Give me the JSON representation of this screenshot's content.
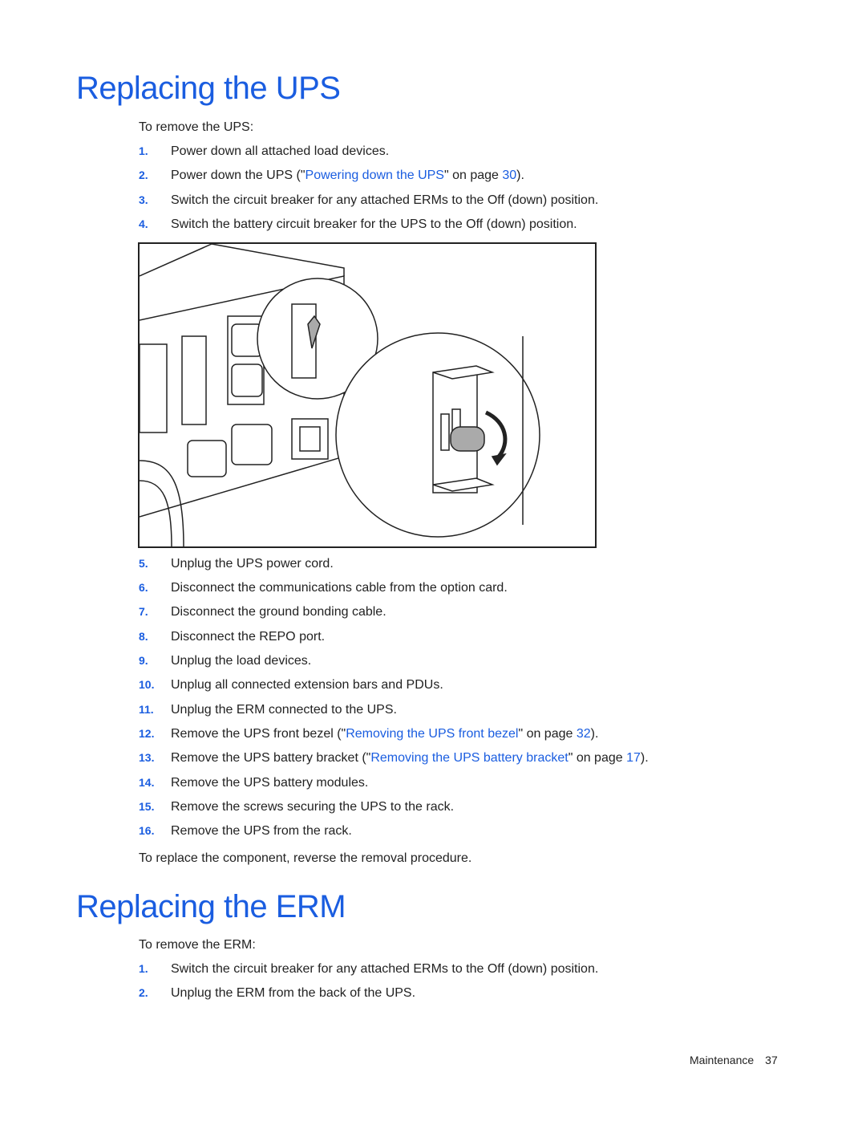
{
  "sections": [
    {
      "title": "Replacing the UPS",
      "intro": "To remove the UPS:",
      "steps": [
        {
          "num": "1.",
          "text": "Power down all attached load devices."
        },
        {
          "num": "2.",
          "pre": "Power down the UPS (\"",
          "link": "Powering down the UPS",
          "mid": "\" on page ",
          "page_link": "30",
          "post": ")."
        },
        {
          "num": "3.",
          "text": "Switch the circuit breaker for any attached ERMs to the Off (down) position."
        },
        {
          "num": "4.",
          "text": "Switch the battery circuit breaker for the UPS to the Off (down) position."
        },
        {
          "num": "5.",
          "text": "Unplug the UPS power cord."
        },
        {
          "num": "6.",
          "text": "Disconnect the communications cable from the option card."
        },
        {
          "num": "7.",
          "text": "Disconnect the ground bonding cable."
        },
        {
          "num": "8.",
          "text": "Disconnect the REPO port."
        },
        {
          "num": "9.",
          "text": "Unplug the load devices."
        },
        {
          "num": "10.",
          "text": "Unplug all connected extension bars and PDUs."
        },
        {
          "num": "11.",
          "text": "Unplug the ERM connected to the UPS."
        },
        {
          "num": "12.",
          "pre": "Remove the UPS front bezel (\"",
          "link": "Removing the UPS front bezel",
          "mid": "\" on page ",
          "page_link": "32",
          "post": ")."
        },
        {
          "num": "13.",
          "pre": "Remove the UPS battery bracket (\"",
          "link": "Removing the UPS battery bracket",
          "mid": "\" on page ",
          "page_link": "17",
          "post": ")."
        },
        {
          "num": "14.",
          "text": "Remove the UPS battery modules."
        },
        {
          "num": "15.",
          "text": "Remove the screws securing the UPS to the rack."
        },
        {
          "num": "16.",
          "text": "Remove the UPS from the rack."
        }
      ],
      "outro": "To replace the component, reverse the removal procedure."
    },
    {
      "title": "Replacing the ERM",
      "intro": "To remove the ERM:",
      "steps": [
        {
          "num": "1.",
          "text": "Switch the circuit breaker for any attached ERMs to the Off (down) position."
        },
        {
          "num": "2.",
          "text": "Unplug the ERM from the back of the UPS."
        }
      ]
    }
  ],
  "figure": {
    "description": "UPS rear panel with battery circuit breaker magnified, arrow showing switch to Off (down)"
  },
  "footer": {
    "section": "Maintenance",
    "page": "37"
  },
  "colors": {
    "accent": "#1a5de0",
    "text": "#222222"
  }
}
